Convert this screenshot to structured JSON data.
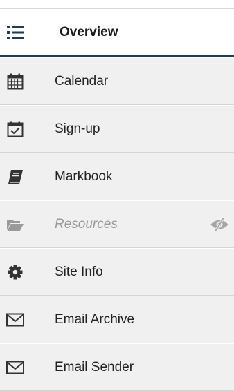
{
  "menu": {
    "items": [
      {
        "label": "Overview",
        "icon": "list-icon",
        "active": true,
        "hidden": false
      },
      {
        "label": "Calendar",
        "icon": "calendar-icon",
        "active": false,
        "hidden": false
      },
      {
        "label": "Sign-up",
        "icon": "calendar-check-icon",
        "active": false,
        "hidden": false
      },
      {
        "label": "Markbook",
        "icon": "book-icon",
        "active": false,
        "hidden": false
      },
      {
        "label": "Resources",
        "icon": "folder-open-icon",
        "active": false,
        "hidden": true
      },
      {
        "label": "Site Info",
        "icon": "gear-icon",
        "active": false,
        "hidden": false
      },
      {
        "label": "Email Archive",
        "icon": "envelope-icon",
        "active": false,
        "hidden": false
      },
      {
        "label": "Email Sender",
        "icon": "envelope-icon",
        "active": false,
        "hidden": false
      }
    ]
  },
  "colors": {
    "active_border": "#1f3b56",
    "item_background": "#f0f0f0",
    "hidden_text": "#9a9a9a"
  }
}
